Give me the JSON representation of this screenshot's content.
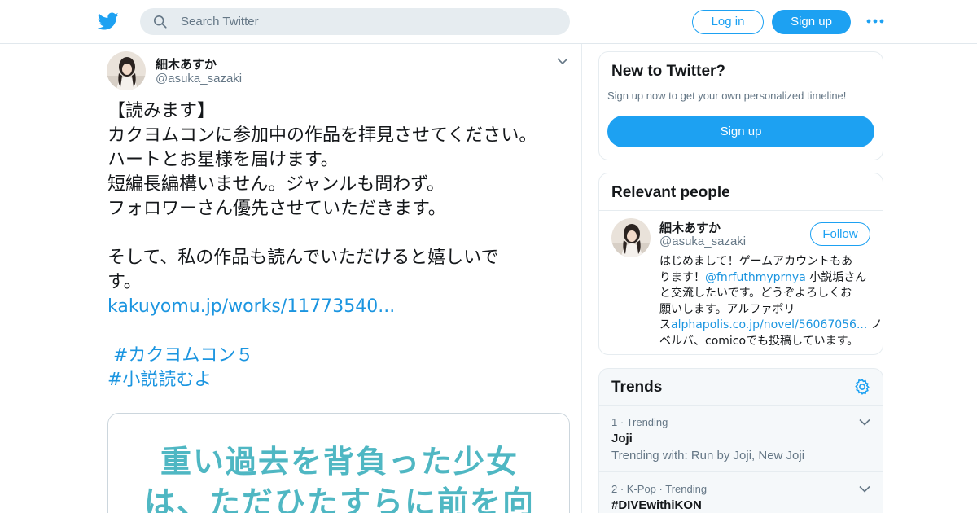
{
  "header": {
    "logo_icon": "twitter-bird-icon",
    "search": {
      "placeholder": "Search Twitter"
    },
    "login_label": "Log in",
    "signup_label": "Sign up",
    "more_icon": "more-dots-icon",
    "accent_color": "#1da1f2"
  },
  "tweet": {
    "name": "細木あすか",
    "handle": "@asuka_sazaki",
    "lines": [
      "【読みます】",
      "カクヨムコンに参加中の作品を拝見させてください。",
      "ハートとお星様を届けます。",
      "短編長編構いません。ジャンルも問わず。",
      "フォロワーさん優先させていただきます。",
      "",
      "そして、私の作品も読んでいただけると嬉しいで",
      "す。"
    ],
    "link": "kakuyomu.jp/works/11773540...",
    "hashtag1": " #カクヨムコン５",
    "hashtag2": "#小説読むよ",
    "media_lines": [
      "重い過去を背負った少女",
      "は、ただひたすらに前を向"
    ]
  },
  "new_to_twitter": {
    "title": "New to Twitter?",
    "subtitle": "Sign up now to get your own personalized timeline!",
    "button": "Sign up"
  },
  "relevant_people": {
    "title": "Relevant people",
    "name": "細木あすか",
    "handle": "@asuka_sazaki",
    "follow_label": "Follow",
    "bio": {
      "l1": "はじめまして！ゲームアカウントもあ",
      "l2_pre": "ります！",
      "l2_link": "@fnrfuthmyprnya",
      "l2_post": " 小説垢さん",
      "l3": "と交流したいです。どうぞよろしくお",
      "l4": "願いします。アルファポリ",
      "l5_pre": "ス",
      "l5_link": "alphapolis.co.jp/novel/56067056...",
      "l5_post": " ノ",
      "l6": "ベルバ、comicoでも投稿しています。"
    }
  },
  "trends": {
    "title": "Trends",
    "settings_icon": "gear-icon",
    "items": [
      {
        "meta": "1 · Trending",
        "title": "Joji",
        "with": "Trending with: Run by Joji, New Joji"
      },
      {
        "meta": "2 · K-Pop · Trending",
        "title": "#DIVEwithiKON"
      }
    ]
  }
}
